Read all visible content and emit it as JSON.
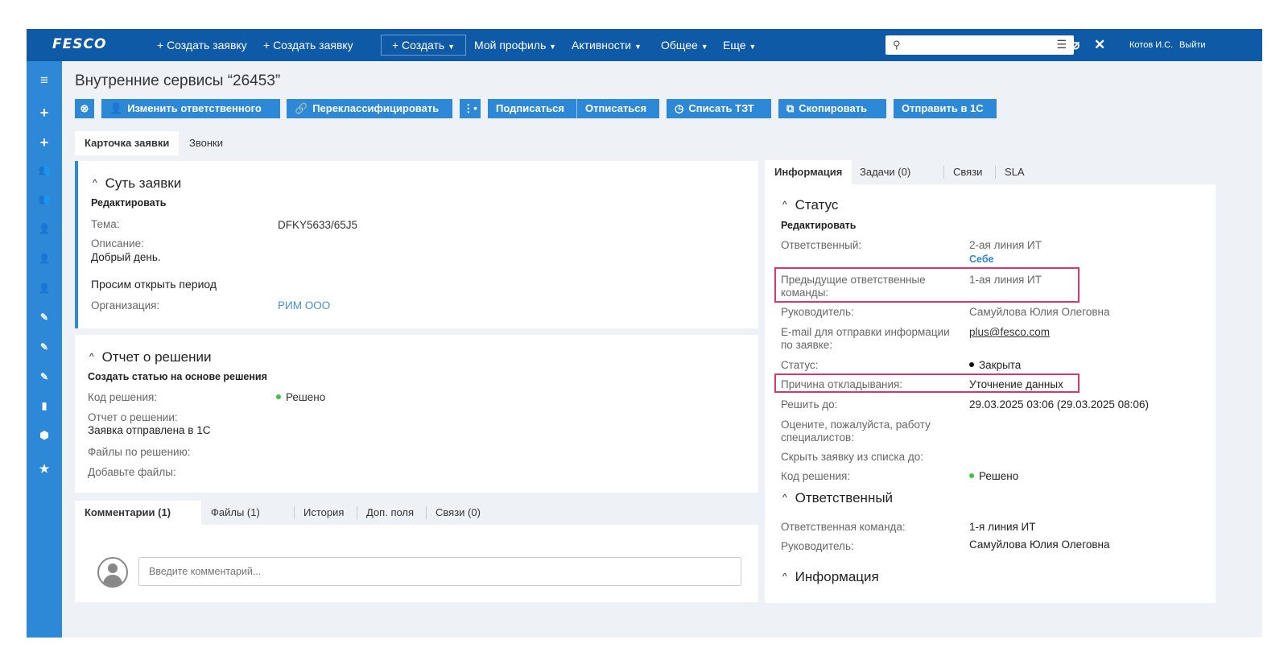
{
  "topbar": {
    "logo": "FESCO",
    "create_request_1": "+ Создать заявку",
    "create_request_2": "+ Создать заявку",
    "create_dropdown": "+ Создать",
    "menu": [
      "Мой профиль",
      "Активности",
      "Общее",
      "Еще"
    ],
    "search_icon": "search-icon",
    "filter_icon": "filter-icon",
    "user": "Котов И.С.",
    "logout": "Выйти"
  },
  "header": {
    "title": "Внутренние сервисы “26453”"
  },
  "actions": {
    "change_owner": "Изменить ответственного",
    "reclassify": "Переклассифицировать",
    "subscribe": "Подписаться",
    "unsubscribe": "Отписаться",
    "write_off": "Списать ТЗТ",
    "copy": "Скопировать",
    "send_1c": "Отправить в 1С"
  },
  "main_tabs": [
    "Карточка заявки",
    "Звонки"
  ],
  "essence": {
    "title": "Суть заявки",
    "edit": "Редактировать",
    "topic_label": "Тема:",
    "topic_value": "DFKY5633/65J5",
    "description_label": "Описание:",
    "description_value": "Добрый день.",
    "description_text": "Просим открыть период",
    "org_label": "Организация:",
    "org_value": "РИМ ООО"
  },
  "solution": {
    "title": "Отчет о решении",
    "create_article": "Создать статью на основе решения",
    "code_label": "Код решения:",
    "code_value": "Решено",
    "report_label": "Отчет о решении:",
    "report_value": "Заявка отправлена в 1С",
    "files_label": "Файлы по решению:",
    "add_files_label": "Добавьте файлы:"
  },
  "bottom_tabs": [
    "Комментарии (1)",
    "Файлы (1)",
    "История",
    "Доп. поля",
    "Связи (0)"
  ],
  "comment": {
    "placeholder": "Введите комментарий..."
  },
  "right_tabs": [
    "Информация",
    "Задачи (0)",
    "Связи",
    "SLA"
  ],
  "status": {
    "title": "Статус",
    "edit": "Редактировать",
    "owner_label": "Ответственный:",
    "owner_value": "2-ая линия ИТ",
    "self_link": "Себе",
    "prev_teams_label_1": "Предыдущие ответственные",
    "prev_teams_label_2": "команды:",
    "prev_teams_value": "1-ая линия ИТ",
    "manager_label": "Руководитель:",
    "manager_value": "Самуйлова Юлия Олеговна",
    "email_label_1": "E-mail для отправки информации",
    "email_label_2": "по заявке:",
    "email_value": "plus@fesco.com",
    "status_label": "Статус:",
    "status_value": "Закрыта",
    "postpone_label": "Причина откладывания:",
    "postpone_value": "Уточнение данных",
    "due_label": "Решить до:",
    "due_value": "29.03.2025 03:06 (29.03.2025 08:06)",
    "rate_label_1": "Оцените, пожалуйста, работу",
    "rate_label_2": "специалистов:",
    "hide_label": "Скрыть заявку из списка до:",
    "code_label": "Код решения:",
    "code_value": "Решено"
  },
  "responsible": {
    "title": "Ответственный",
    "team_label": "Ответственная команда:",
    "team_value": "1-я линия ИТ",
    "manager_label": "Руководитель:",
    "manager_value": "Самуйлова Юлия Олеговна"
  },
  "info_section": {
    "title": "Информация"
  },
  "colors": {
    "topbar": "#0e5aa7",
    "sidebar": "#2d89d8",
    "accent": "#2d89d8",
    "highlight": "#d7386b",
    "resolved": "#3cc24a"
  }
}
